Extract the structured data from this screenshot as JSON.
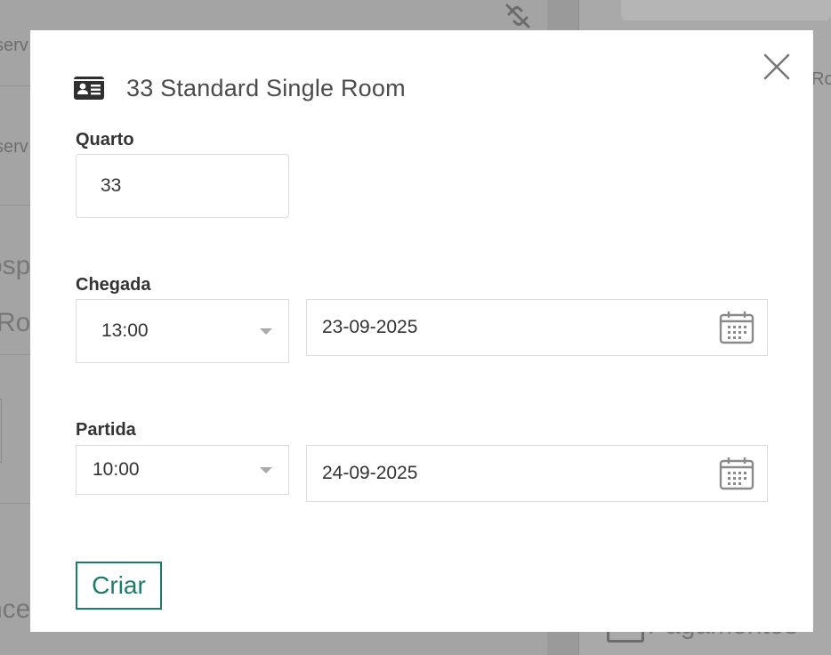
{
  "background": {
    "left_fragments": [
      "serv",
      "serv",
      "ósp",
      "Roo",
      "nce"
    ],
    "right_fragments": [
      "Roo",
      "Pagamentos"
    ]
  },
  "modal": {
    "header_icon": "id-card-icon",
    "title": "33 Standard Single Room",
    "close_icon": "close-icon",
    "room": {
      "label": "Quarto",
      "value": "33"
    },
    "arrival": {
      "label": "Chegada",
      "time": "13:00",
      "date": "23-09-2025",
      "calendar_icon": "calendar-icon"
    },
    "departure": {
      "label": "Partida",
      "time": "10:00",
      "date": "24-09-2025",
      "calendar_icon": "calendar-icon"
    },
    "create_button": "Criar"
  },
  "colors": {
    "accent": "#1e7a6a",
    "overlay": "#9a9a9a",
    "modal_bg": "#ffffff"
  }
}
